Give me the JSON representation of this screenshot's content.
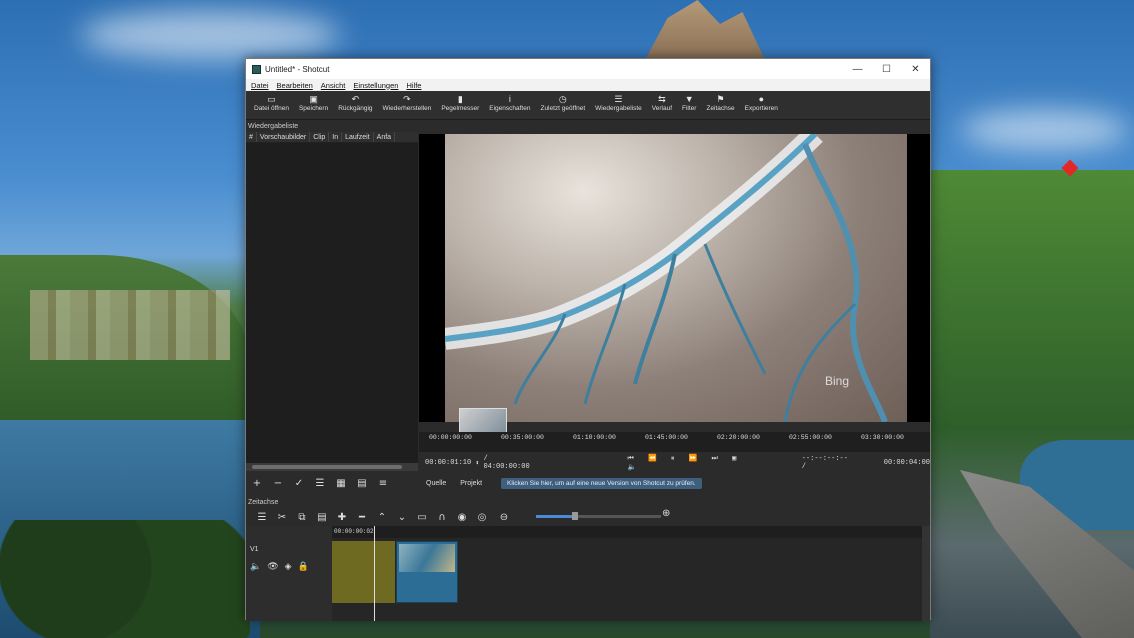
{
  "window": {
    "title": "Untitled* - Shotcut",
    "minimize": "—",
    "maximize": "☐",
    "close": "✕"
  },
  "menu": [
    "Datei",
    "Bearbeiten",
    "Ansicht",
    "Einstellungen",
    "Hilfe"
  ],
  "toolbar": [
    {
      "label": "Datei öffnen",
      "icon": "folder-open-icon",
      "glyph": "▭"
    },
    {
      "label": "Speichern",
      "icon": "save-icon",
      "glyph": "▣"
    },
    {
      "label": "Rückgängig",
      "icon": "undo-icon",
      "glyph": "↶"
    },
    {
      "label": "Wiederherstellen",
      "icon": "redo-icon",
      "glyph": "↷"
    },
    {
      "label": "Pegelmesser",
      "icon": "meter-icon",
      "glyph": "▮"
    },
    {
      "label": "Eigenschaften",
      "icon": "info-icon",
      "glyph": "i"
    },
    {
      "label": "Zuletzt geöffnet",
      "icon": "clock-icon",
      "glyph": "◷"
    },
    {
      "label": "Wiedergabeliste",
      "icon": "list-icon",
      "glyph": "☰"
    },
    {
      "label": "Verlauf",
      "icon": "history-icon",
      "glyph": "⇆"
    },
    {
      "label": "Filter",
      "icon": "filter-icon",
      "glyph": "▼"
    },
    {
      "label": "Zeitachse",
      "icon": "flag-icon",
      "glyph": "⚑"
    },
    {
      "label": "Exportieren",
      "icon": "export-icon",
      "glyph": "●"
    }
  ],
  "playlist": {
    "title": "Wiedergabeliste",
    "columns": [
      "#",
      "Vorschaubilder",
      "Clip",
      "In",
      "Laufzeit",
      "Anfa"
    ],
    "tools": [
      "+",
      "−",
      "✓",
      "☰",
      "▦",
      "▤",
      "≡"
    ]
  },
  "viewer": {
    "watermark": "Bing"
  },
  "ruler": [
    "00:00:00:00",
    "00:35:00:00",
    "01:10:00:00",
    "01:45:00:00",
    "02:20:00:00",
    "02:55:00:00",
    "03:30:00:00"
  ],
  "transport": {
    "current": "00:00:01:10",
    "total": "/ 04:00:00:00",
    "in_out": "--:--:--:-- /",
    "duration": "00:00:04:00"
  },
  "tabs": {
    "source": "Quelle",
    "project": "Projekt"
  },
  "notice": "Klicken Sie hier, um auf eine neue Version von Shotcut zu prüfen.",
  "timeline": {
    "title": "Zeitachse",
    "ruler_start": "00:00:00:02",
    "track": "V1",
    "zoom_level": 0.3
  }
}
